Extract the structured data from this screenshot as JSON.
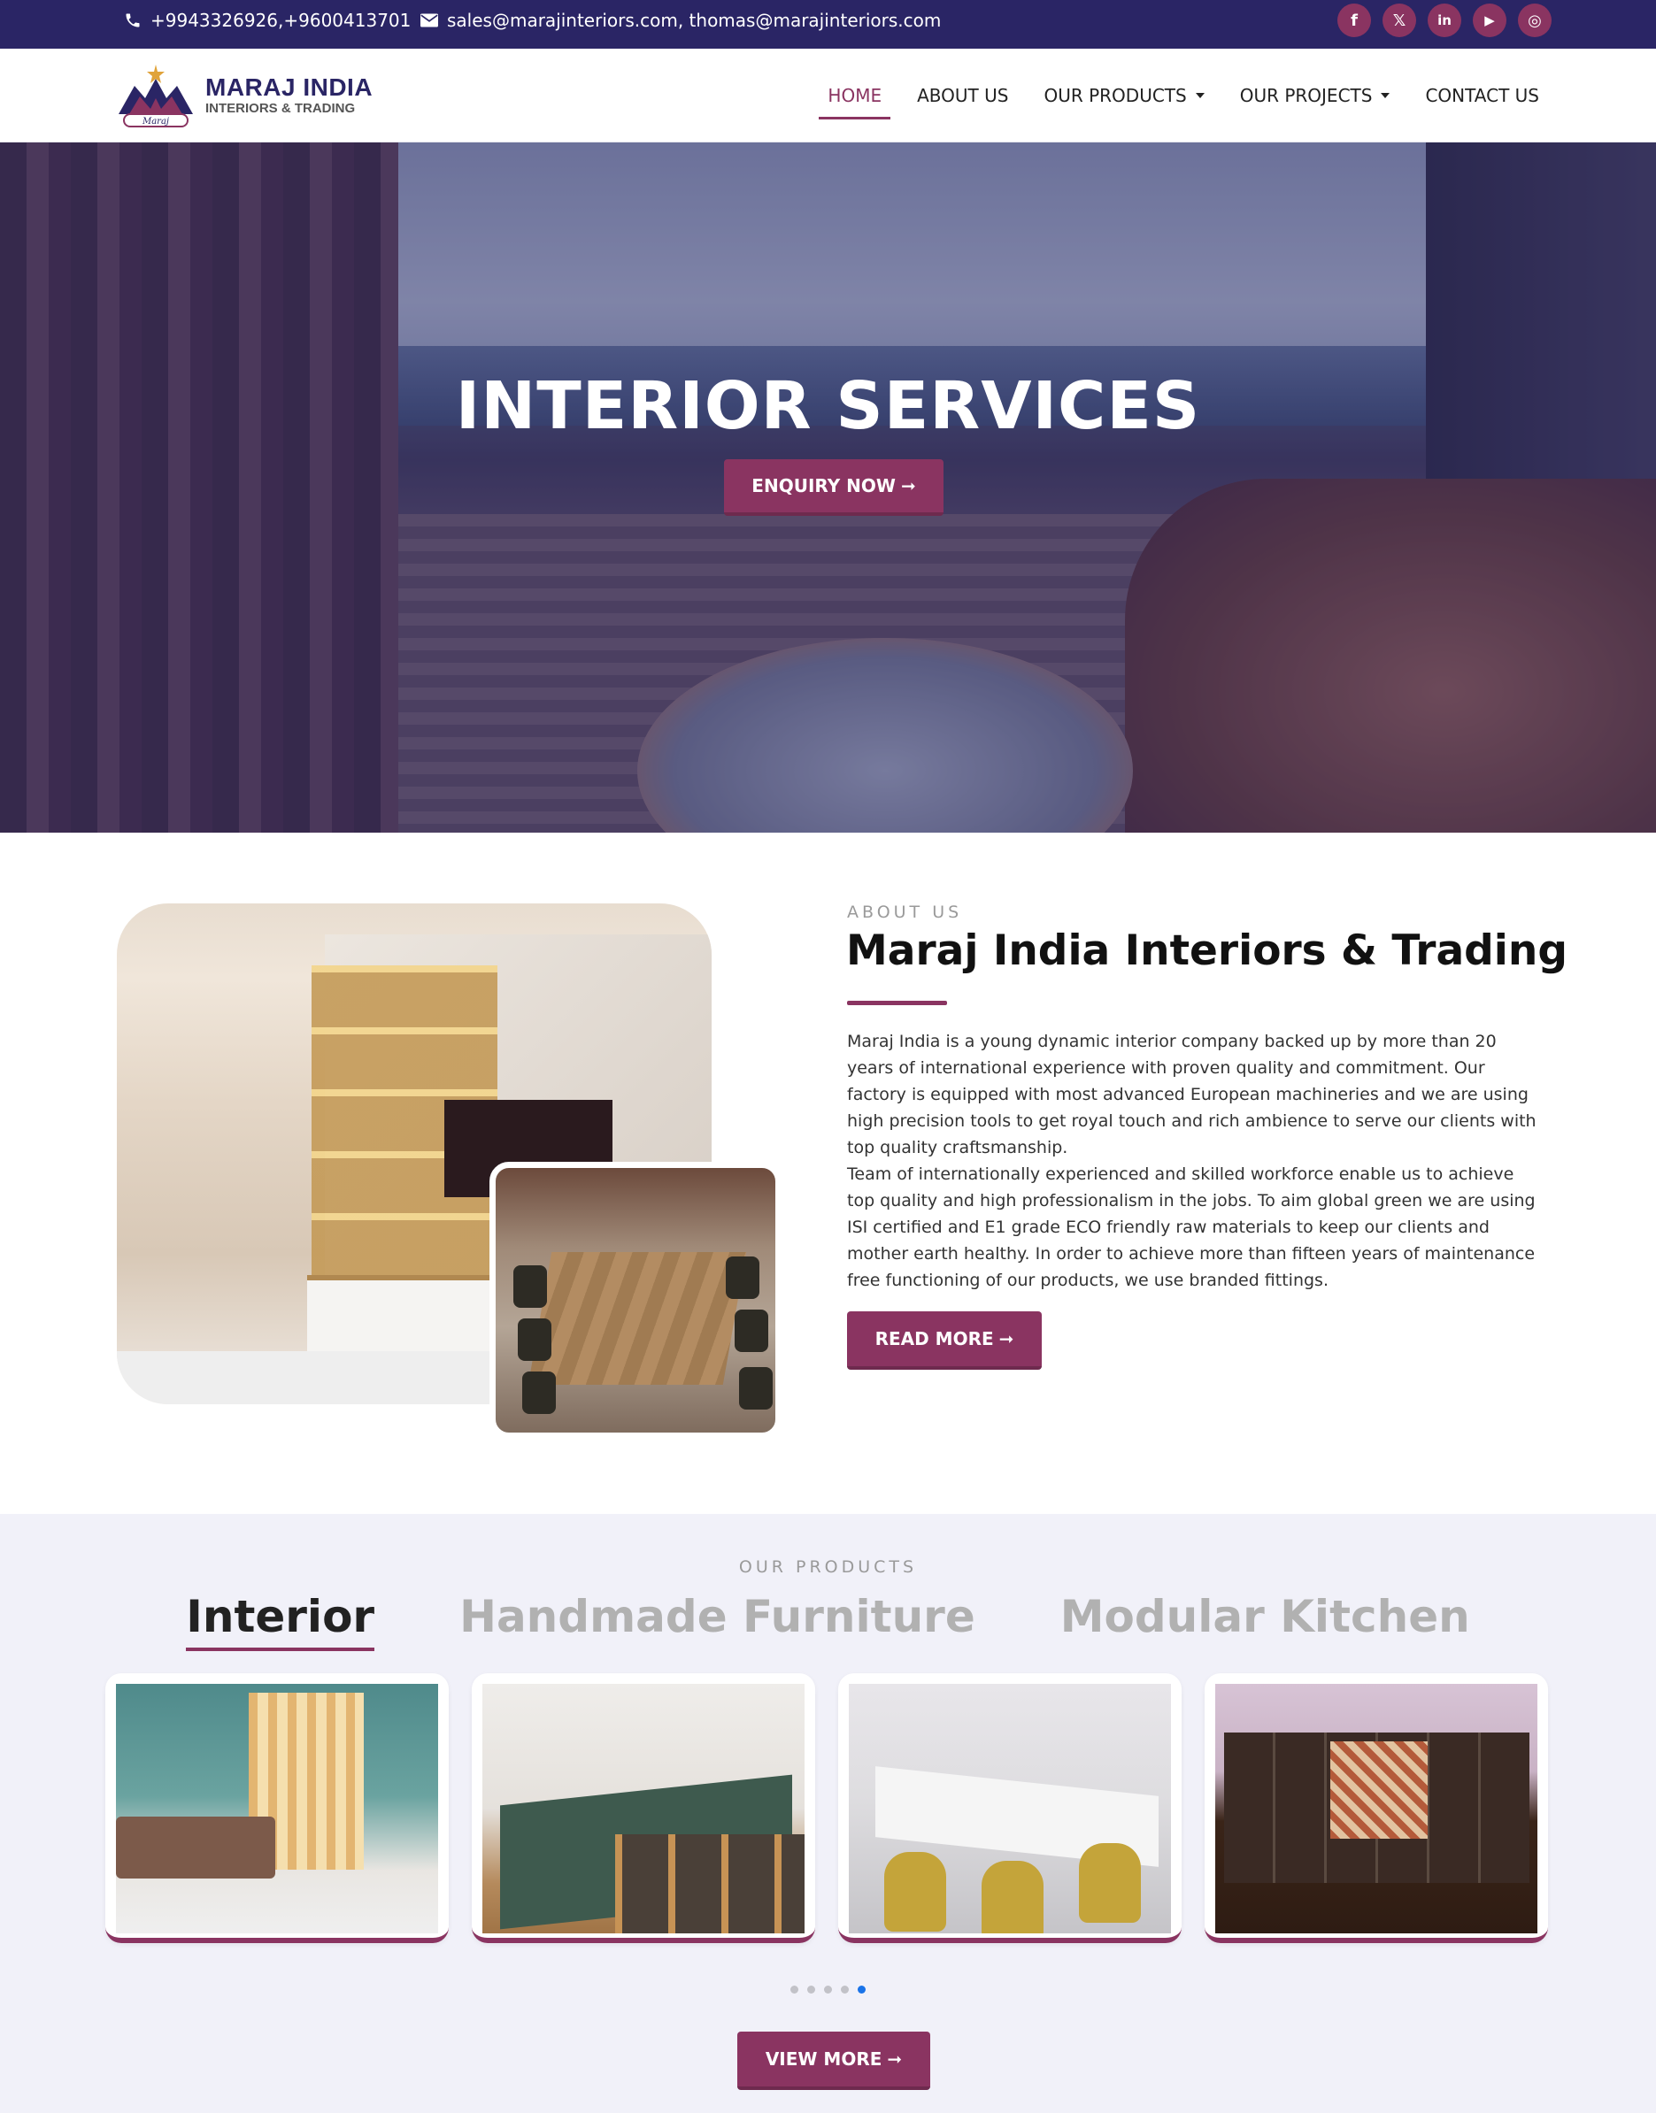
{
  "topbar": {
    "phone": "+9943326926,+9600413701",
    "email": "sales@marajinteriors.com, thomas@marajinteriors.com",
    "socials": [
      {
        "name": "facebook-icon",
        "glyph": "f"
      },
      {
        "name": "x-icon",
        "glyph": "𝕏"
      },
      {
        "name": "linkedin-icon",
        "glyph": "in"
      },
      {
        "name": "youtube-icon",
        "glyph": "▶"
      },
      {
        "name": "instagram-icon",
        "glyph": "◎"
      }
    ]
  },
  "logo": {
    "brand_mark": "Maraj",
    "title": "MARAJ INDIA",
    "subtitle": "INTERIORS & TRADING"
  },
  "nav": {
    "items": [
      {
        "label": "HOME",
        "active": true
      },
      {
        "label": "ABOUT US"
      },
      {
        "label": "OUR PRODUCTS",
        "dropdown": true
      },
      {
        "label": "OUR PROJECTS",
        "dropdown": true
      },
      {
        "label": "CONTACT US"
      }
    ]
  },
  "hero": {
    "title": "INTERIOR SERVICES",
    "button": "ENQUIRY NOW"
  },
  "about": {
    "eyebrow": "ABOUT US",
    "title": "Maraj India Interiors & Trading",
    "paragraph1": "Maraj India is a young dynamic interior company backed up by more than 20 years of international experience with proven quality and commitment. Our factory is equipped with most advanced European machineries and we are using high precision tools to get royal touch and rich ambience to serve our clients with top quality craftsmanship.",
    "paragraph2": "Team of internationally experienced and skilled workforce enable us to achieve top quality and high professionalism in the jobs. To aim global green we are using ISI certified and E1 grade ECO friendly raw materials to keep our clients and mother earth healthy. In order to achieve more than fifteen years of maintenance free functioning of our products, we use branded fittings.",
    "button": "READ MORE"
  },
  "products": {
    "eyebrow": "OUR PRODUCTS",
    "tabs": [
      {
        "label": "Interior",
        "active": true
      },
      {
        "label": "Handmade Furniture"
      },
      {
        "label": "Modular Kitchen"
      }
    ],
    "carousel": {
      "slides": 5,
      "active_slide": 5
    },
    "button": "VIEW MORE"
  },
  "colors": {
    "brand_navy": "#2a2565",
    "brand_plum": "#8a3461",
    "products_bg": "#f1f1f9",
    "dot_active": "#1a73e8"
  }
}
